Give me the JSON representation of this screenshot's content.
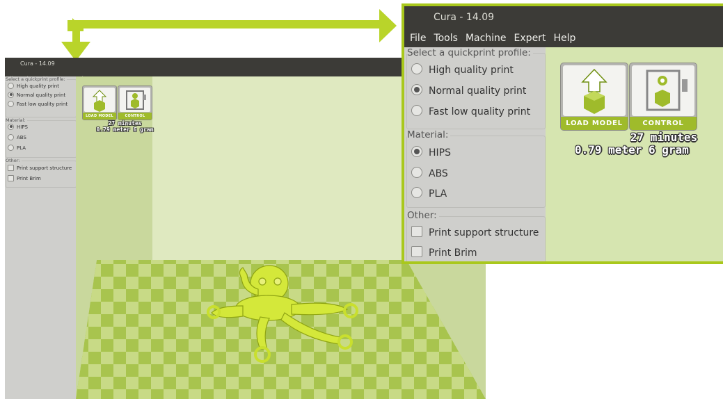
{
  "app": {
    "title": "Cura - 14.09"
  },
  "menu": [
    "File",
    "Tools",
    "Machine",
    "Expert",
    "Help"
  ],
  "sidebar": {
    "profile_header": "Select a quickprint profile:",
    "profiles": [
      {
        "label": "High quality print",
        "selected": false
      },
      {
        "label": "Normal quality print",
        "selected": true
      },
      {
        "label": "Fast low quality print",
        "selected": false
      }
    ],
    "material_header": "Material:",
    "materials": [
      {
        "label": "HIPS",
        "selected": true
      },
      {
        "label": "ABS",
        "selected": false
      },
      {
        "label": "PLA",
        "selected": false
      }
    ],
    "other_header": "Other:",
    "other": [
      {
        "label": "Print support structure",
        "checked": false
      },
      {
        "label": "Print Brim",
        "checked": false
      }
    ]
  },
  "toolbar": {
    "load_label": "LOAD MODEL",
    "control_label": "CONTROL"
  },
  "stats": {
    "time": "27 minutes",
    "material": "0.79 meter 6 gram"
  },
  "colors": {
    "accent": "#a9c81c",
    "button_caption": "#9fbb2b",
    "model": "#d4e83a",
    "titlebar": "#3c3b37",
    "sidebar": "#cfcfcc"
  },
  "icons": [
    "upload-arrow-icon",
    "cube-icon",
    "printer-icon",
    "location-pin-icon",
    "octopus-model"
  ]
}
